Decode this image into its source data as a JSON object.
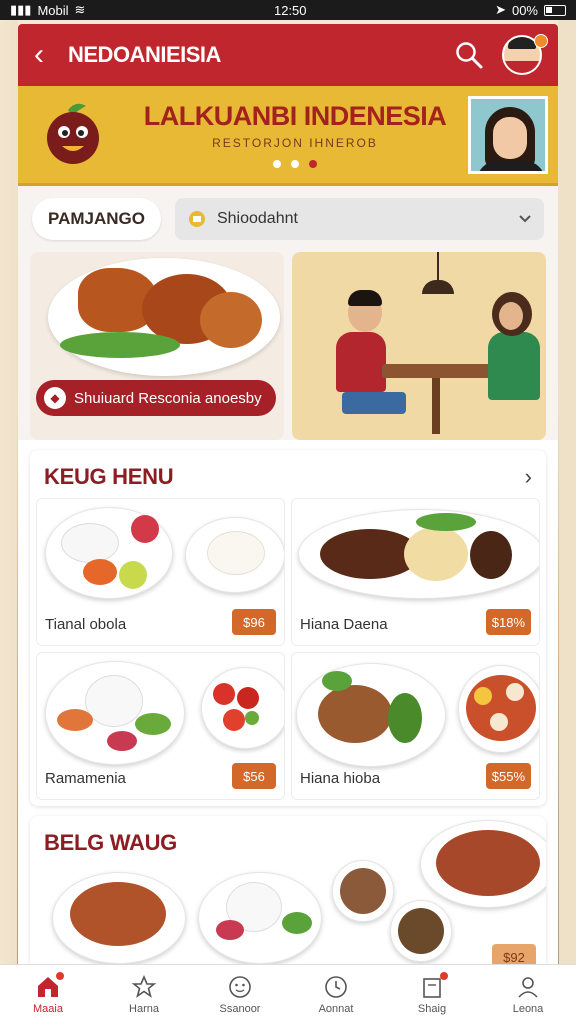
{
  "status_bar": {
    "carrier": "Mobil",
    "time": "12:50",
    "battery": "00%"
  },
  "header": {
    "title": "NEDOANIEISIA",
    "back_icon": "chevron-left-icon",
    "search_icon": "search-icon"
  },
  "banner": {
    "brand": "LALKUANBI INDENESIA",
    "tagline": "RESTORJON IHNEROB"
  },
  "filter": {
    "label": "PAMJANGO",
    "select_value": "Shioodahnt"
  },
  "hero": {
    "cta_label": "Shuiuard Resconia anoesby"
  },
  "menu": {
    "title": "KEUG HENU",
    "items": [
      {
        "name": "Tianal obola",
        "price": "$96"
      },
      {
        "name": "Hiana Daena",
        "price": "$18%"
      },
      {
        "name": "Ramamenia",
        "price": "$56"
      },
      {
        "name": "Hiana hioba",
        "price": "$55%"
      }
    ]
  },
  "section2": {
    "title": "BELG WAUG",
    "price": "$92"
  },
  "nav": [
    {
      "label": "Maaia",
      "icon": "home-icon"
    },
    {
      "label": "Harna",
      "icon": "star-icon"
    },
    {
      "label": "Ssanoor",
      "icon": "face-icon"
    },
    {
      "label": "Aonnat",
      "icon": "clock-icon"
    },
    {
      "label": "Shaig",
      "icon": "bag-icon"
    },
    {
      "label": "Leona",
      "icon": "user-icon"
    }
  ],
  "colors": {
    "brand_red": "#c0262d",
    "banner_yellow": "#e7b934",
    "price_orange": "#d2692a"
  }
}
